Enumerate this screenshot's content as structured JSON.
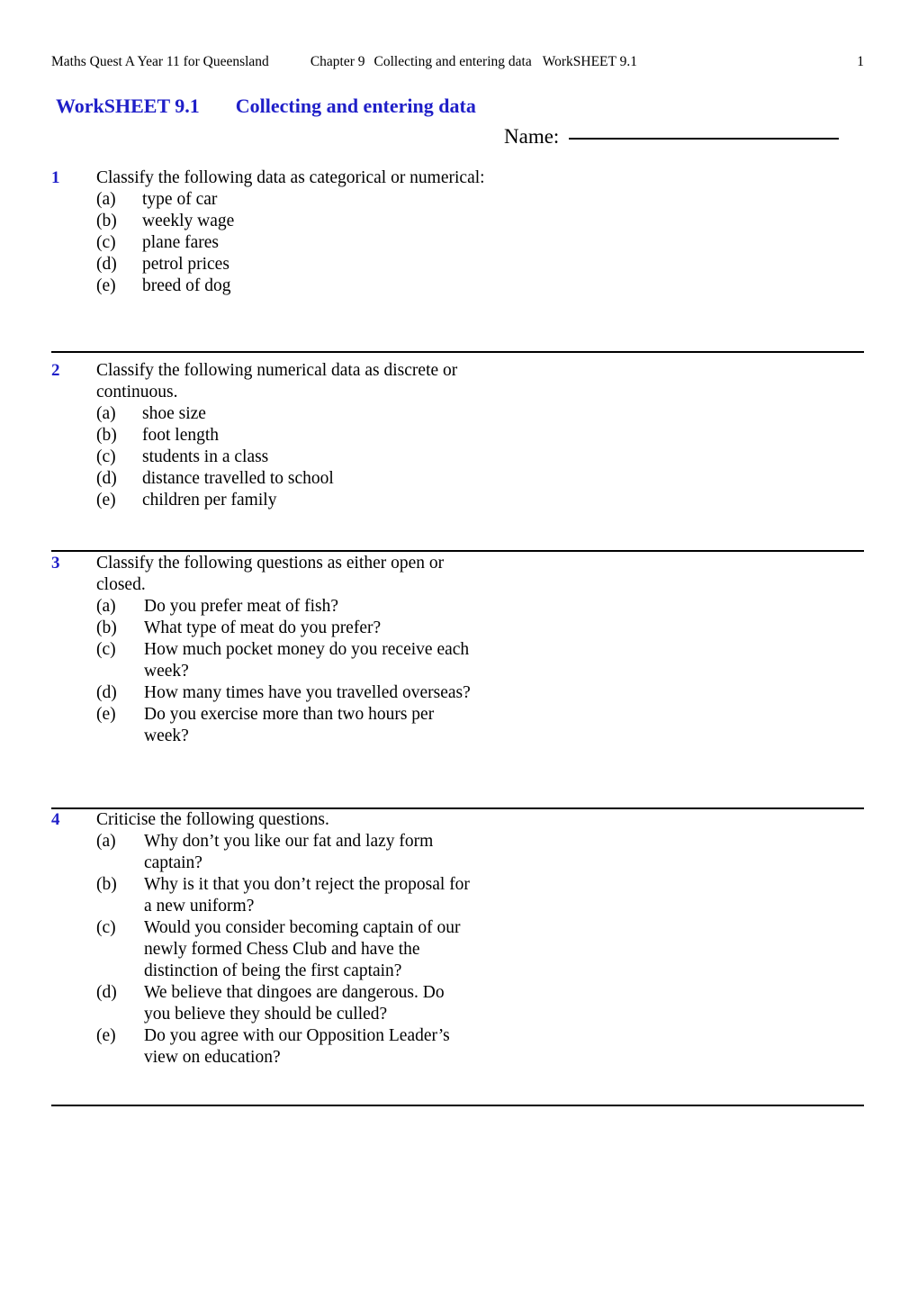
{
  "header": {
    "book": "Maths Quest A Year 11 for Queensland",
    "chapter": "Chapter 9",
    "topic": "Collecting and entering data",
    "worksheet": "WorkSHEET 9.1",
    "page_number": "1"
  },
  "title": {
    "sheet": "WorkSHEET 9.1",
    "topic": "Collecting and entering data",
    "accent_color": "#1f1fc8"
  },
  "name_field": {
    "label": "Name:",
    "value": ""
  },
  "questions": [
    {
      "number": "1",
      "stem": "Classify the following data as categorical or numerical:",
      "items": [
        {
          "label": "(a)",
          "text": "type of car"
        },
        {
          "label": "(b)",
          "text": "weekly wage"
        },
        {
          "label": "(c)",
          "text": "plane fares"
        },
        {
          "label": "(d)",
          "text": "petrol prices"
        },
        {
          "label": "(e)",
          "text": "breed of dog"
        }
      ]
    },
    {
      "number": "2",
      "stem": "Classify the following numerical data as discrete or continuous.",
      "items": [
        {
          "label": "(a)",
          "text": "shoe size"
        },
        {
          "label": "(b)",
          "text": "foot length"
        },
        {
          "label": "(c)",
          "text": "students in a class"
        },
        {
          "label": "(d)",
          "text": "distance travelled to school"
        },
        {
          "label": "(e)",
          "text": "children per family"
        }
      ]
    },
    {
      "number": "3",
      "stem": "Classify the following questions as either open or closed.",
      "items": [
        {
          "label": "(a)",
          "text": "Do you prefer meat of fish?"
        },
        {
          "label": "(b)",
          "text": "What type of meat do you prefer?"
        },
        {
          "label": "(c)",
          "text": "How much pocket money do you receive each week?"
        },
        {
          "label": "(d)",
          "text": "How many times have you travelled overseas?"
        },
        {
          "label": "(e)",
          "text": "Do you exercise more than two hours per week?"
        }
      ]
    },
    {
      "number": "4",
      "stem": "Criticise the following questions.",
      "items": [
        {
          "label": "(a)",
          "text": "Why don’t you like our fat and lazy form captain?"
        },
        {
          "label": "(b)",
          "text": "Why is it that you don’t reject the proposal for a new uniform?"
        },
        {
          "label": "(c)",
          "text": "Would you consider becoming captain of our newly formed Chess Club and have the distinction of being the first captain?"
        },
        {
          "label": "(d)",
          "text": "We believe that dingoes are dangerous. Do you believe they should be culled?"
        },
        {
          "label": "(e)",
          "text": "Do you agree with our Opposition Leader’s view on education?"
        }
      ]
    }
  ]
}
